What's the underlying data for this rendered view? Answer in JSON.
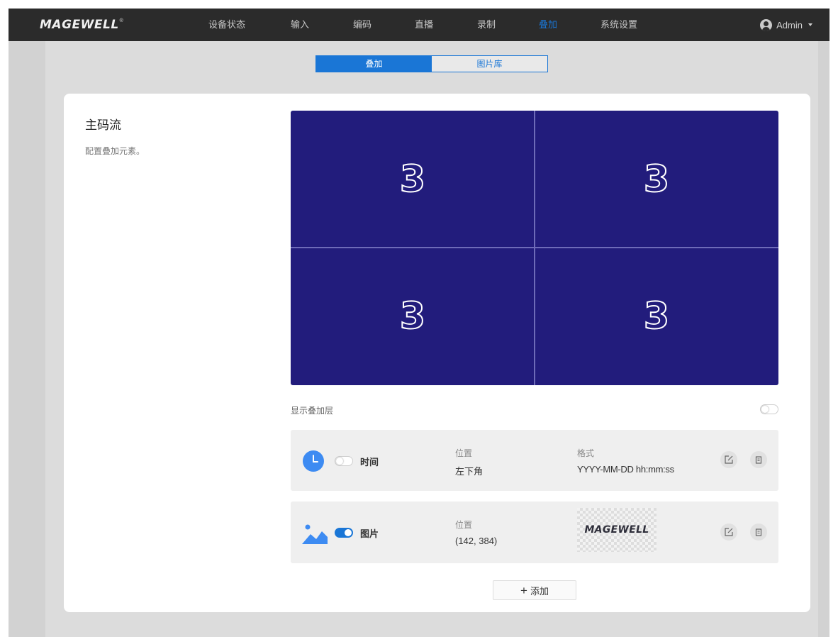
{
  "brand": {
    "logo": "MAGEWELL",
    "reg": "®"
  },
  "nav": {
    "items": [
      {
        "label": "设备状态",
        "active": false
      },
      {
        "label": "输入",
        "active": false
      },
      {
        "label": "编码",
        "active": false
      },
      {
        "label": "直播",
        "active": false
      },
      {
        "label": "录制",
        "active": false
      },
      {
        "label": "叠加",
        "active": true
      },
      {
        "label": "系统设置",
        "active": false
      }
    ],
    "user": "Admin"
  },
  "tabs": [
    {
      "label": "叠加",
      "active": true
    },
    {
      "label": "图片库",
      "active": false
    }
  ],
  "section": {
    "title": "主码流",
    "description": "配置叠加元素。"
  },
  "preview": {
    "quadrants": [
      "3",
      "3",
      "3",
      "3"
    ],
    "background": "#221c7c"
  },
  "show_overlay": {
    "label": "显示叠加层",
    "enabled": false
  },
  "overlays": [
    {
      "type": "时间",
      "icon": "clock-icon",
      "enabled": false,
      "position_label": "位置",
      "position_value": "左下角",
      "format_label": "格式",
      "format_value": "YYYY-MM-DD hh:mm:ss"
    },
    {
      "type": "图片",
      "icon": "image-icon",
      "enabled": true,
      "position_label": "位置",
      "position_value": "(142, 384)",
      "preview_logo": "MAGEWELL"
    }
  ],
  "add_button": "添加",
  "colors": {
    "accent": "#1a76d6",
    "topbar": "#2b2b2b",
    "preview_bg": "#221c7c"
  }
}
